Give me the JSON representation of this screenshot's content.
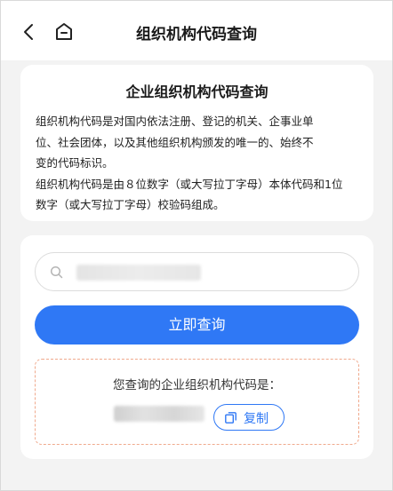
{
  "header": {
    "title": "组织机构代码查询",
    "back_icon": "chevron-left-icon",
    "home_icon": "home-icon"
  },
  "info": {
    "title": "企业组织机构代码查询",
    "lines": [
      "组织机构代码是对国内依法注册、登记的机关、企事业单",
      "位、社会团体，以及其他组织机构颁发的唯一的、始终不",
      "变的代码标识。",
      "组织机构代码是由８位数字（或大写拉丁字母）本体代码和1位",
      "数字（或大写拉丁字母）校验码组成。"
    ]
  },
  "search": {
    "icon": "search-icon",
    "value": ""
  },
  "query_button": {
    "label": "立即查询"
  },
  "result": {
    "label": "您查询的企业组织机构代码是：",
    "copy_label": "复制",
    "copy_icon": "copy-icon"
  },
  "colors": {
    "accent": "#2f78f5",
    "result_border": "#f0a98c",
    "background": "#f3f3f3"
  }
}
